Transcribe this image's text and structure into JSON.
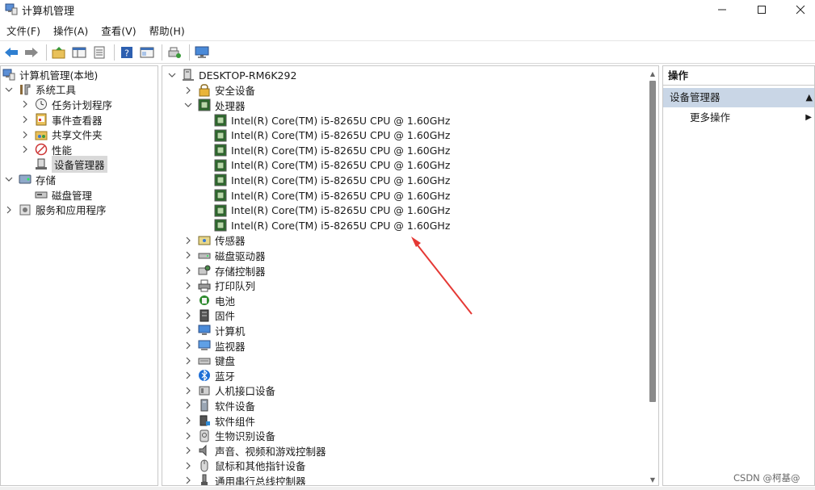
{
  "window": {
    "title": "计算机管理",
    "controls": [
      "minimize",
      "maximize",
      "close"
    ]
  },
  "menu": [
    "文件(F)",
    "操作(A)",
    "查看(V)",
    "帮助(H)"
  ],
  "toolbar_icons": [
    "back-icon",
    "forward-icon",
    "up-folder-icon",
    "show-hide-tree-icon",
    "export-list-icon",
    "help-icon",
    "properties-icon",
    "scan-hardware-icon",
    "monitor-icon"
  ],
  "left_tree": [
    {
      "label": "计算机管理(本地)",
      "icon": "computer-management-icon",
      "level": 0,
      "chevron": "",
      "selected": false
    },
    {
      "label": "系统工具",
      "icon": "tools-icon",
      "level": 0,
      "chevron": "expanded",
      "selected": false
    },
    {
      "label": "任务计划程序",
      "icon": "clock-icon",
      "level": 1,
      "chevron": "collapsed",
      "selected": false
    },
    {
      "label": "事件查看器",
      "icon": "event-viewer-icon",
      "level": 1,
      "chevron": "collapsed",
      "selected": false
    },
    {
      "label": "共享文件夹",
      "icon": "shared-folder-icon",
      "level": 1,
      "chevron": "collapsed",
      "selected": false
    },
    {
      "label": "性能",
      "icon": "performance-icon",
      "level": 1,
      "chevron": "collapsed",
      "selected": false
    },
    {
      "label": "设备管理器",
      "icon": "device-manager-icon",
      "level": 1,
      "chevron": "",
      "selected": true
    },
    {
      "label": "存储",
      "icon": "storage-icon",
      "level": 0,
      "chevron": "expanded",
      "selected": false
    },
    {
      "label": "磁盘管理",
      "icon": "disk-icon",
      "level": 1,
      "chevron": "",
      "selected": false
    },
    {
      "label": "服务和应用程序",
      "icon": "services-icon",
      "level": 0,
      "chevron": "collapsed",
      "selected": false
    }
  ],
  "device_tree": {
    "root": "DESKTOP-RM6K292",
    "items": [
      {
        "label": "安全设备",
        "icon": "security-device-icon",
        "level": 1,
        "chevron": "collapsed"
      },
      {
        "label": "处理器",
        "icon": "processor-icon",
        "level": 1,
        "chevron": "expanded"
      },
      {
        "label": "Intel(R) Core(TM) i5-8265U CPU @ 1.60GHz",
        "icon": "processor-icon",
        "level": 2,
        "chevron": ""
      },
      {
        "label": "Intel(R) Core(TM) i5-8265U CPU @ 1.60GHz",
        "icon": "processor-icon",
        "level": 2,
        "chevron": ""
      },
      {
        "label": "Intel(R) Core(TM) i5-8265U CPU @ 1.60GHz",
        "icon": "processor-icon",
        "level": 2,
        "chevron": ""
      },
      {
        "label": "Intel(R) Core(TM) i5-8265U CPU @ 1.60GHz",
        "icon": "processor-icon",
        "level": 2,
        "chevron": ""
      },
      {
        "label": "Intel(R) Core(TM) i5-8265U CPU @ 1.60GHz",
        "icon": "processor-icon",
        "level": 2,
        "chevron": ""
      },
      {
        "label": "Intel(R) Core(TM) i5-8265U CPU @ 1.60GHz",
        "icon": "processor-icon",
        "level": 2,
        "chevron": ""
      },
      {
        "label": "Intel(R) Core(TM) i5-8265U CPU @ 1.60GHz",
        "icon": "processor-icon",
        "level": 2,
        "chevron": ""
      },
      {
        "label": "Intel(R) Core(TM) i5-8265U CPU @ 1.60GHz",
        "icon": "processor-icon",
        "level": 2,
        "chevron": ""
      },
      {
        "label": "传感器",
        "icon": "sensor-icon",
        "level": 1,
        "chevron": "collapsed"
      },
      {
        "label": "磁盘驱动器",
        "icon": "disk-drive-icon",
        "level": 1,
        "chevron": "collapsed"
      },
      {
        "label": "存储控制器",
        "icon": "storage-controller-icon",
        "level": 1,
        "chevron": "collapsed"
      },
      {
        "label": "打印队列",
        "icon": "printer-icon",
        "level": 1,
        "chevron": "collapsed"
      },
      {
        "label": "电池",
        "icon": "battery-icon",
        "level": 1,
        "chevron": "collapsed"
      },
      {
        "label": "固件",
        "icon": "firmware-icon",
        "level": 1,
        "chevron": "collapsed"
      },
      {
        "label": "计算机",
        "icon": "computer-icon",
        "level": 1,
        "chevron": "collapsed"
      },
      {
        "label": "监视器",
        "icon": "monitor-icon",
        "level": 1,
        "chevron": "collapsed"
      },
      {
        "label": "键盘",
        "icon": "keyboard-icon",
        "level": 1,
        "chevron": "collapsed"
      },
      {
        "label": "蓝牙",
        "icon": "bluetooth-icon",
        "level": 1,
        "chevron": "collapsed"
      },
      {
        "label": "人机接口设备",
        "icon": "hid-icon",
        "level": 1,
        "chevron": "collapsed"
      },
      {
        "label": "软件设备",
        "icon": "software-device-icon",
        "level": 1,
        "chevron": "collapsed"
      },
      {
        "label": "软件组件",
        "icon": "software-component-icon",
        "level": 1,
        "chevron": "collapsed"
      },
      {
        "label": "生物识别设备",
        "icon": "biometric-icon",
        "level": 1,
        "chevron": "collapsed"
      },
      {
        "label": "声音、视频和游戏控制器",
        "icon": "speaker-icon",
        "level": 1,
        "chevron": "collapsed"
      },
      {
        "label": "鼠标和其他指针设备",
        "icon": "mouse-icon",
        "level": 1,
        "chevron": "collapsed"
      },
      {
        "label": "通用串行总线控制器",
        "icon": "usb-icon",
        "level": 1,
        "chevron": "collapsed"
      }
    ]
  },
  "actions": {
    "header": "操作",
    "group": "设备管理器",
    "more": "更多操作"
  },
  "annotation": {
    "arrow_color": "#e53935"
  },
  "watermark": "CSDN @柯基@"
}
